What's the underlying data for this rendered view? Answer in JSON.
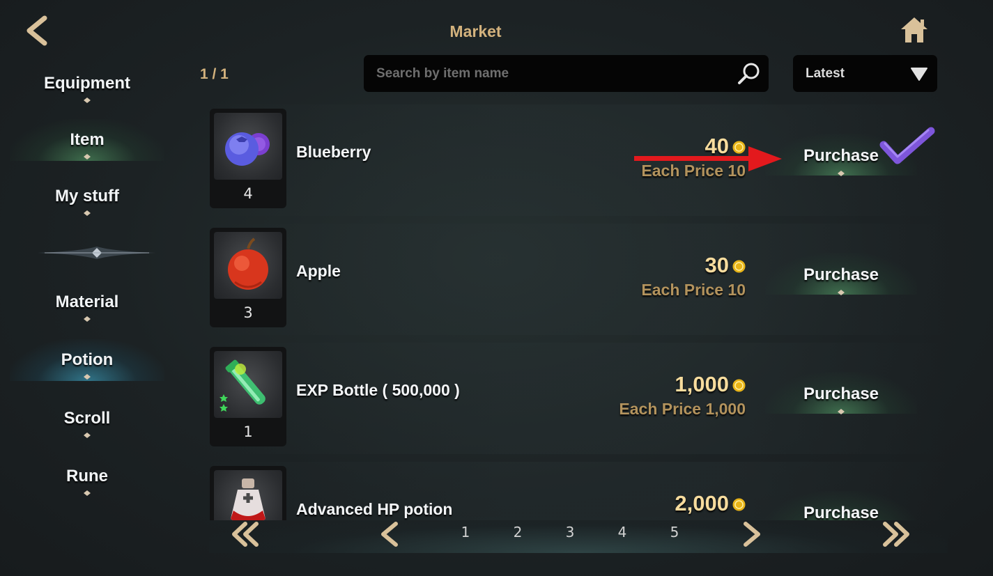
{
  "header": {
    "title": "Market",
    "back_icon": "chevron-left-icon",
    "home_icon": "home-icon"
  },
  "sidebar": {
    "items": [
      {
        "label": "Equipment",
        "active": false
      },
      {
        "label": "Item",
        "active": true
      },
      {
        "label": "My stuff",
        "active": false
      },
      {
        "label": "Material",
        "active": false
      },
      {
        "label": "Potion",
        "active": true
      },
      {
        "label": "Scroll",
        "active": false
      },
      {
        "label": "Rune",
        "active": false
      }
    ]
  },
  "page_indicator": "1 / 1",
  "search": {
    "placeholder": "Search by item name",
    "value": ""
  },
  "sort": {
    "selected": "Latest"
  },
  "items": [
    {
      "name": "Blueberry",
      "quantity": "4",
      "total": "40",
      "each": "Each Price 10",
      "button": "Purchase",
      "icon": "blueberry-icon"
    },
    {
      "name": "Apple",
      "quantity": "3",
      "total": "30",
      "each": "Each Price 10",
      "button": "Purchase",
      "icon": "apple-icon"
    },
    {
      "name": "EXP Bottle ( 500,000 )",
      "quantity": "1",
      "total": "1,000",
      "each": "Each Price 1,000",
      "button": "Purchase",
      "icon": "exp-bottle-icon"
    },
    {
      "name": "Advanced HP potion",
      "quantity": "",
      "total": "2,000",
      "each": "",
      "button": "Purchase",
      "icon": "hp-potion-icon"
    }
  ],
  "pagination": {
    "pages": [
      "1",
      "2",
      "3",
      "4",
      "5"
    ]
  },
  "colors": {
    "gold_title": "#d3b27d",
    "price_total": "#f7dc9e",
    "price_each": "#b3935d",
    "annotation_arrow": "#e3191d",
    "annotation_check": "#8a5cf0"
  }
}
